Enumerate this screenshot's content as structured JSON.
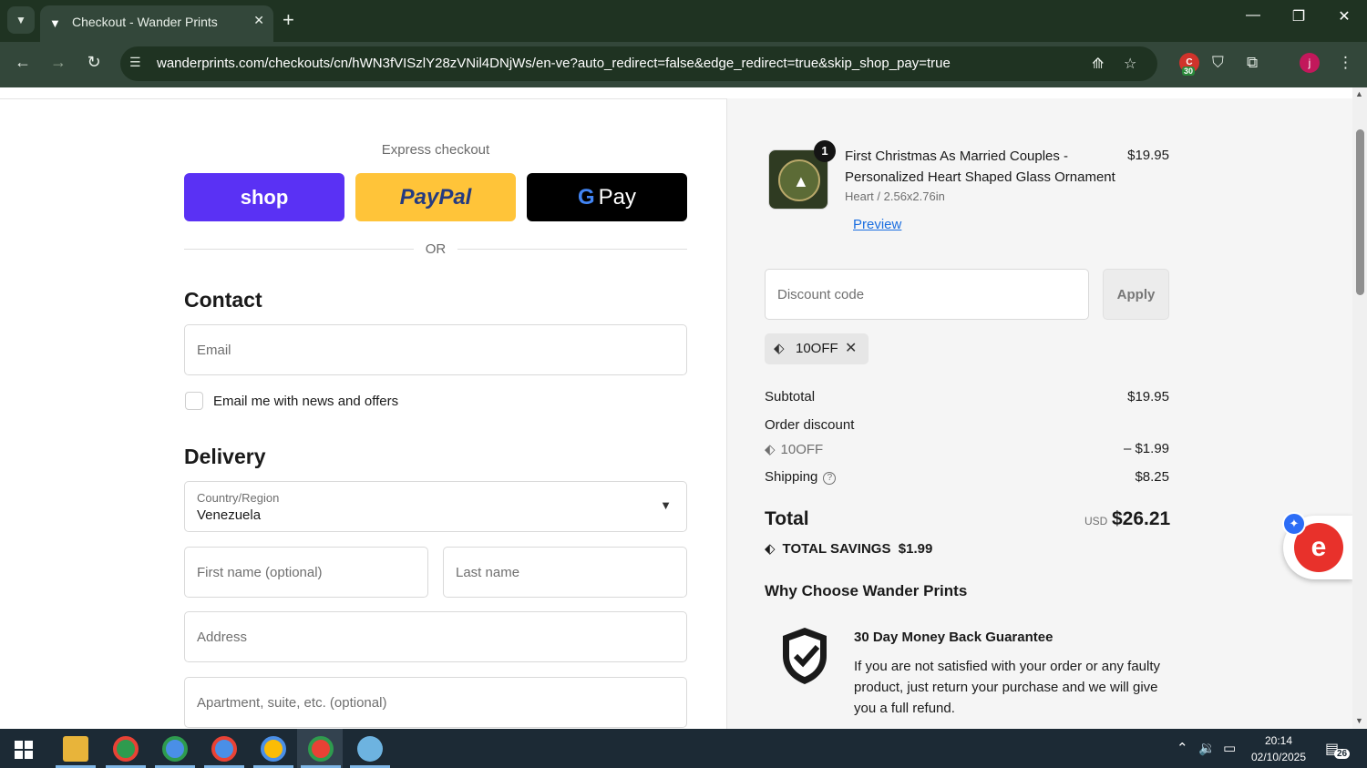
{
  "browser": {
    "tab_title": "Checkout - Wander Prints",
    "url": "wanderprints.com/checkouts/cn/hWN3fVISzlY28zVNil4DNjWs/en-ve?auto_redirect=false&edge_redirect=true&skip_shop_pay=true",
    "extension_badge": "30",
    "profile_initial": "j"
  },
  "express": {
    "label": "Express checkout",
    "shop_label": "shop",
    "paypal_label": "PayPal",
    "gpay_g": "G",
    "gpay_label": "Pay",
    "or_label": "OR"
  },
  "contact": {
    "title": "Contact",
    "email_placeholder": "Email",
    "newsletter_label": "Email me with news and offers"
  },
  "delivery": {
    "title": "Delivery",
    "country_label": "Country/Region",
    "country_value": "Venezuela",
    "first_name_placeholder": "First name (optional)",
    "last_name_placeholder": "Last name",
    "address_placeholder": "Address",
    "apartment_placeholder": "Apartment, suite, etc. (optional)"
  },
  "order": {
    "quantity": "1",
    "product_name": "First Christmas As Married Couples - Personalized Heart Shaped Glass Ornament",
    "variant": "Heart / 2.56x2.76in",
    "price": "$19.95",
    "preview_label": "Preview"
  },
  "discount": {
    "placeholder": "Discount code",
    "apply_label": "Apply",
    "applied_code": "10OFF"
  },
  "summary": {
    "subtotal_label": "Subtotal",
    "subtotal_value": "$19.95",
    "order_discount_label": "Order discount",
    "discount_code": "10OFF",
    "discount_value": "– $1.99",
    "shipping_label": "Shipping",
    "shipping_value": "$8.25",
    "total_label": "Total",
    "currency": "USD",
    "total_value": "$26.21",
    "savings_label": "TOTAL SAVINGS",
    "savings_value": "$1.99"
  },
  "why": {
    "title": "Why Choose Wander Prints",
    "guarantee_title": "30 Day Money Back Guarantee",
    "guarantee_text": "If you are not satisfied with your order or any faulty product, just return your purchase and we will give you a full refund."
  },
  "taskbar": {
    "time": "20:14",
    "date": "02/10/2025",
    "notifications": "26"
  },
  "colors": {
    "shop_pay": "#5a31f4",
    "paypal": "#ffc439",
    "gpay": "#000000",
    "link": "#1a6ee0",
    "browser_frame": "#1f3322"
  }
}
